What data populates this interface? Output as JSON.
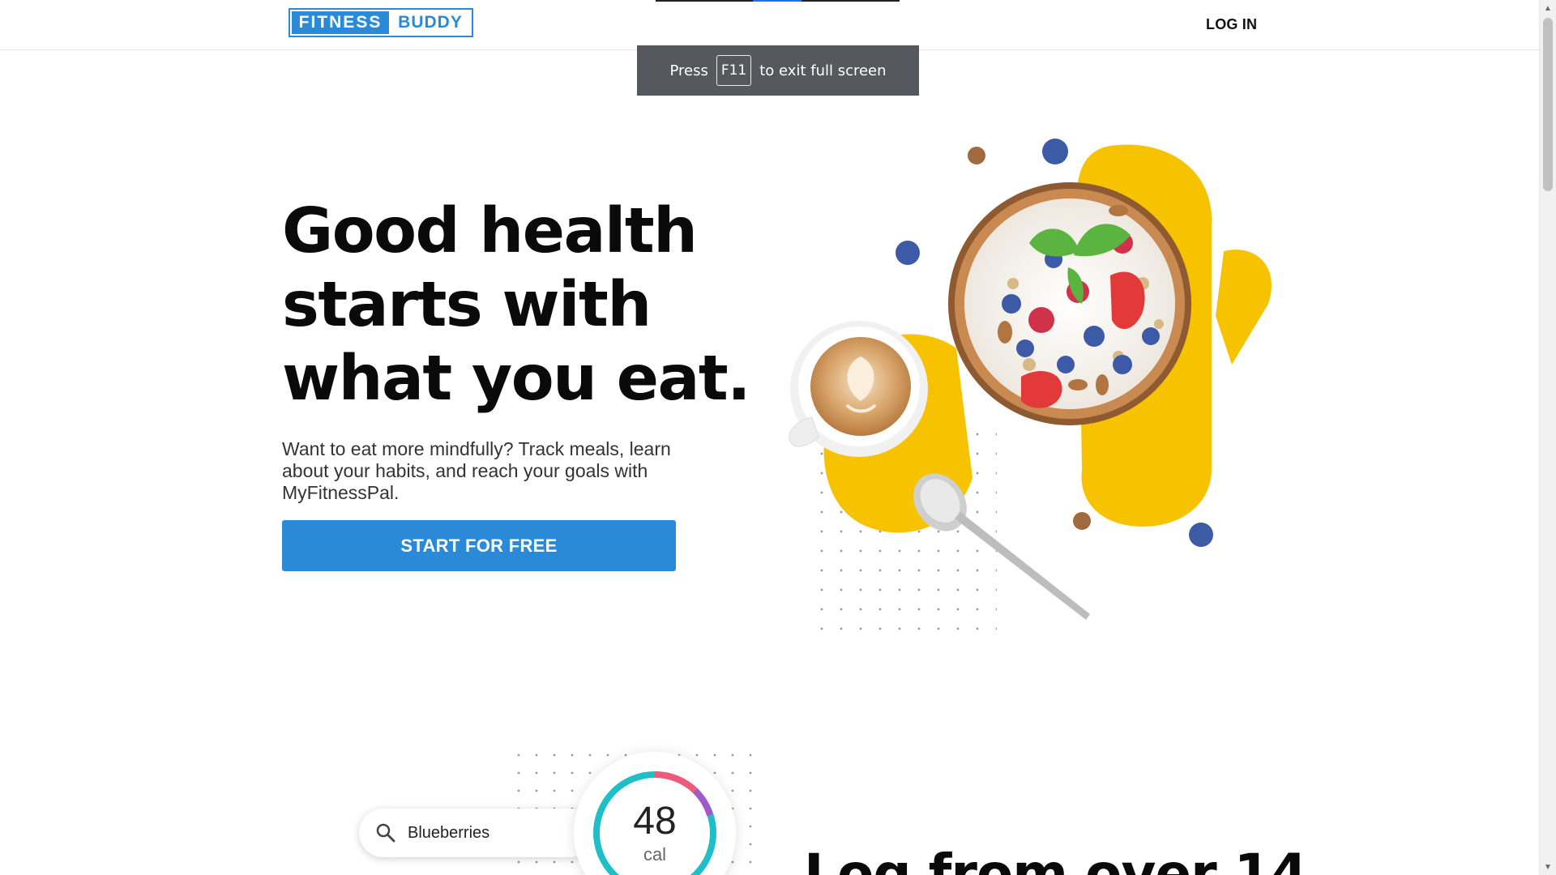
{
  "header": {
    "logo_left": "FITNESS",
    "logo_right": "BUDDY",
    "login": "LOG IN"
  },
  "fullscreen_toast": {
    "press": "Press",
    "key": "F11",
    "suffix": "to exit full screen"
  },
  "hero": {
    "headline": [
      "Good health",
      "starts with",
      "what you eat."
    ],
    "subtext": "Want to eat more mindfully? Track meals, learn about your habits, and reach your goals with MyFitnessPal.",
    "cta": "START FOR FREE"
  },
  "tracker": {
    "search_value": "Blueberries",
    "calories": "48",
    "calories_unit": "cal"
  },
  "section2": {
    "title": "Log from over 14"
  },
  "colors": {
    "brand_blue": "#2a8ad8",
    "accent_yellow": "#f7c300",
    "ring_teal": "#1fbfc9"
  }
}
